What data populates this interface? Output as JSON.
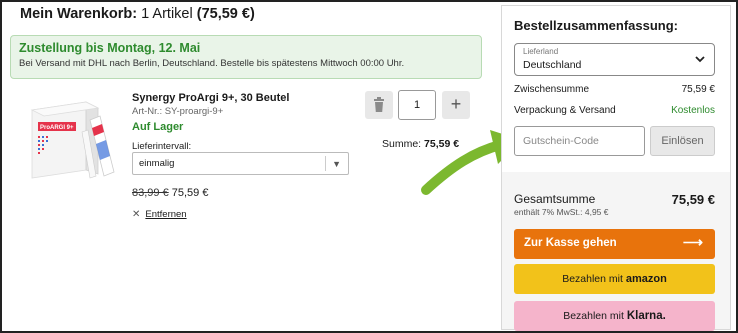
{
  "cart": {
    "title_strong": "Mein Warenkorb:",
    "title_count": " 1 Artikel ",
    "title_total": "(75,59 €)"
  },
  "delivery": {
    "title": "Zustellung bis Montag, 12. Mai",
    "subtitle": "Bei Versand mit DHL nach Berlin, Deutschland. Bestelle bis spätestens Mittwoch 00:00 Uhr."
  },
  "product": {
    "name": "Synergy ProArgi 9+, 30 Beutel",
    "article": "Art-Nr.: SY-proargi-9+",
    "stock": "Auf Lager",
    "interval_label": "Lieferintervall:",
    "interval_value": "einmalig",
    "price_old": "83,99 €",
    "price_new": "75,59 €",
    "remove_label": "Entfernen",
    "quantity": "1",
    "sum_label": "Summe:",
    "sum_value": "75,59 €",
    "image_text": "ProARGI 9+"
  },
  "summary": {
    "title": "Bestellzusammenfassung:",
    "country_label": "Lieferland",
    "country_value": "Deutschland",
    "subtotal_label": "Zwischensumme",
    "subtotal_value": "75,59 €",
    "shipping_label": "Verpackung & Versand",
    "shipping_value": "Kostenlos",
    "coupon_placeholder": "Gutschein-Code",
    "redeem_label": "Einlösen",
    "total_label": "Gesamtsumme",
    "total_value": "75,59 €",
    "tax_note": "enthält 7% MwSt.: 4,95 €",
    "checkout_label": "Zur Kasse gehen",
    "checkout_arrow": "⟶",
    "amazon_prefix": "Bezahlen mit ",
    "amazon_brand": "amazon",
    "klarna_prefix": "Bezahlen mit ",
    "klarna_brand": "Klarna."
  },
  "colors": {
    "accent_green": "#2e8b2e",
    "checkout_orange": "#e8730c",
    "amazon_yellow": "#f2c21a",
    "klarna_pink": "#f5b4cb",
    "arrow_green": "#7cb82f"
  },
  "icons": {
    "trash": "trash-icon",
    "plus": "plus-icon",
    "close": "close-icon",
    "chevron": "chevron-down-icon",
    "arrow": "arrow-icon"
  }
}
